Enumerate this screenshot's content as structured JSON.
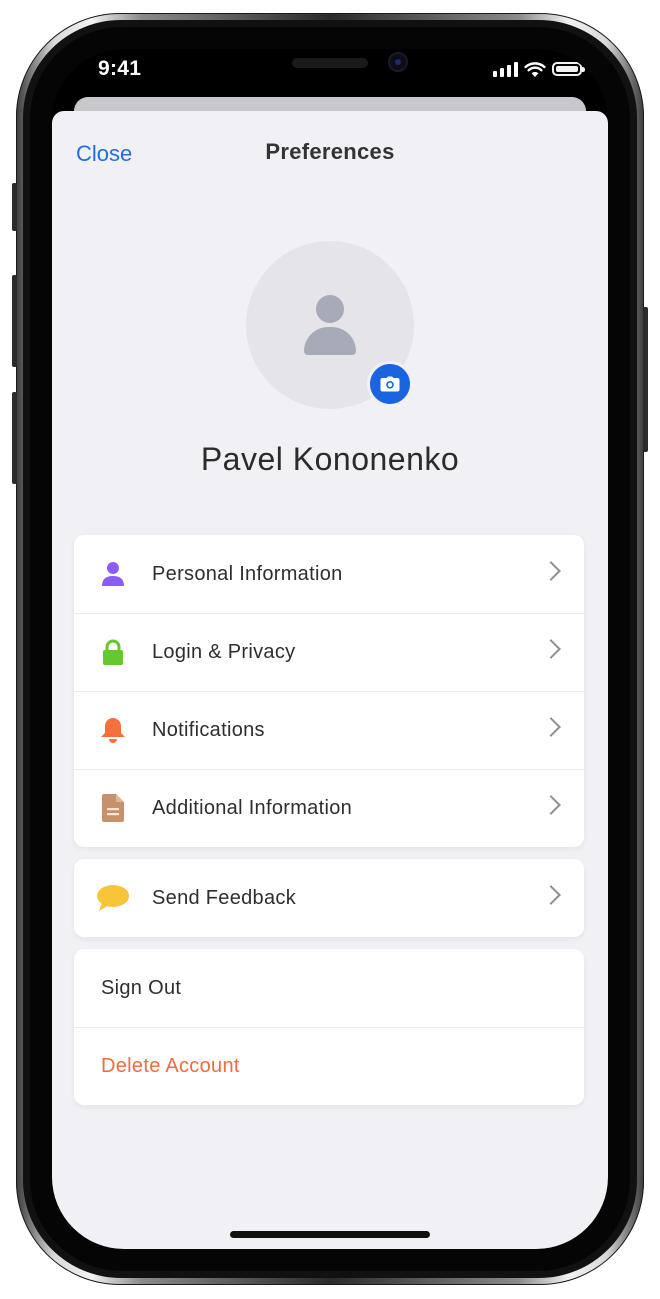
{
  "status_bar": {
    "time": "9:41"
  },
  "nav": {
    "close_label": "Close",
    "title": "Preferences"
  },
  "profile": {
    "name": "Pavel Kononenko"
  },
  "menu_main": [
    {
      "label": "Personal Information",
      "icon": "person-icon",
      "color": "#8b5cf6"
    },
    {
      "label": "Login & Privacy",
      "icon": "lock-icon",
      "color": "#65c82e"
    },
    {
      "label": "Notifications",
      "icon": "bell-icon",
      "color": "#f4703c"
    },
    {
      "label": "Additional Information",
      "icon": "document-icon",
      "color": "#c7916a"
    }
  ],
  "menu_feedback": [
    {
      "label": "Send Feedback",
      "icon": "speech-bubble-icon",
      "color": "#f7c43a"
    }
  ],
  "menu_account": {
    "sign_out": "Sign Out",
    "delete_account": "Delete Account"
  },
  "colors": {
    "accent": "#1f6fe0",
    "danger": "#f26b3a",
    "background": "#f1f1f5"
  }
}
